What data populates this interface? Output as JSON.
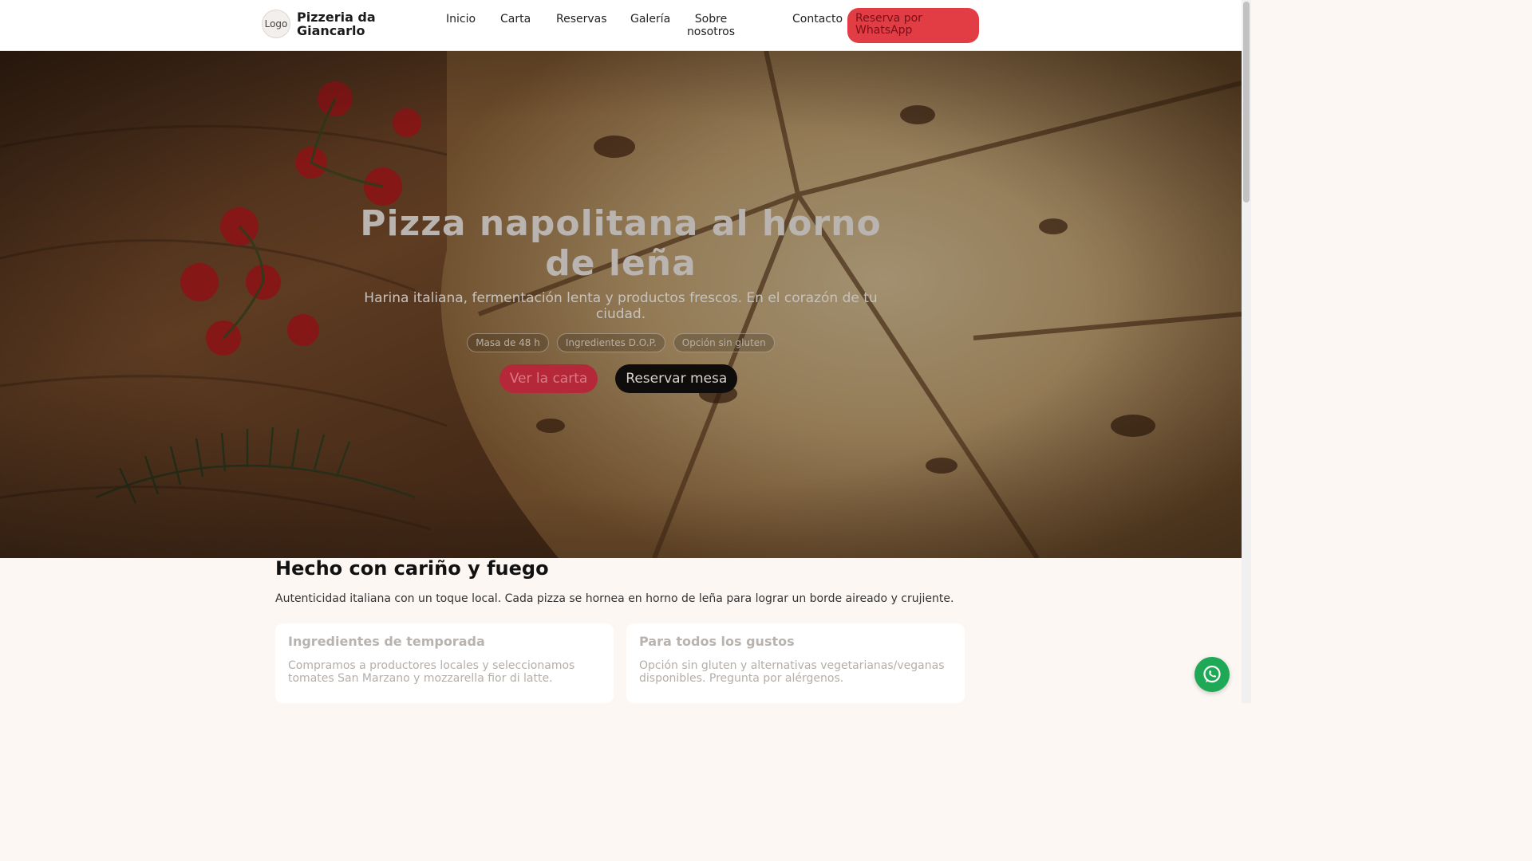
{
  "nav": {
    "logo_alt": "Logo",
    "brand": "Pizzeria da Giancarlo",
    "links": [
      "Inicio",
      "Carta",
      "Reservas",
      "Galería",
      "Sobre nosotros",
      "Contacto"
    ],
    "whatsapp_cta": "Reserva por WhatsApp"
  },
  "hero": {
    "title": "Pizza napolitana al horno de leña",
    "subtitle": "Harina italiana, fermentación lenta y productos frescos. En el corazón de tu ciudad.",
    "badges": [
      "Masa de 48 h",
      "Ingredientes D.O.P.",
      "Opción sin gluten"
    ],
    "primary_cta": "Ver la carta",
    "secondary_cta": "Reservar mesa"
  },
  "about": {
    "title": "Hecho con cariño y fuego",
    "subtitle": "Autenticidad italiana con un toque local. Cada pizza se hornea en horno de leña para lograr un borde aireado y crujiente.",
    "cards": [
      {
        "title": "Ingredientes de temporada",
        "text": "Compramos a productores locales y seleccionamos tomates San Marzano y mozzarella fior di latte."
      },
      {
        "title": "Para todos los gustos",
        "text": "Opción sin gluten y alternativas vegetarianas/veganas disponibles. Pregunta por alérgenos."
      }
    ]
  },
  "fab_icon": "whatsapp-icon",
  "colors": {
    "accent": "#e23c45",
    "whatsapp": "#1fa855",
    "dark_button": "#0f0d0c",
    "background": "#fcf7f3"
  }
}
